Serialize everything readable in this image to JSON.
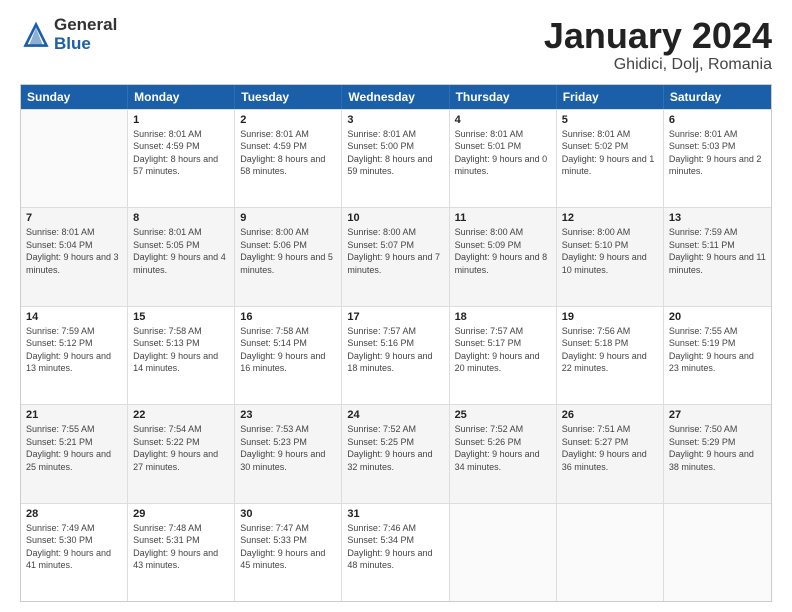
{
  "logo": {
    "general": "General",
    "blue": "Blue"
  },
  "header": {
    "title": "January 2024",
    "subtitle": "Ghidici, Dolj, Romania"
  },
  "weekdays": [
    "Sunday",
    "Monday",
    "Tuesday",
    "Wednesday",
    "Thursday",
    "Friday",
    "Saturday"
  ],
  "weeks": [
    [
      {
        "day": "",
        "sunrise": "",
        "sunset": "",
        "daylight": ""
      },
      {
        "day": "1",
        "sunrise": "Sunrise: 8:01 AM",
        "sunset": "Sunset: 4:59 PM",
        "daylight": "Daylight: 8 hours and 57 minutes."
      },
      {
        "day": "2",
        "sunrise": "Sunrise: 8:01 AM",
        "sunset": "Sunset: 4:59 PM",
        "daylight": "Daylight: 8 hours and 58 minutes."
      },
      {
        "day": "3",
        "sunrise": "Sunrise: 8:01 AM",
        "sunset": "Sunset: 5:00 PM",
        "daylight": "Daylight: 8 hours and 59 minutes."
      },
      {
        "day": "4",
        "sunrise": "Sunrise: 8:01 AM",
        "sunset": "Sunset: 5:01 PM",
        "daylight": "Daylight: 9 hours and 0 minutes."
      },
      {
        "day": "5",
        "sunrise": "Sunrise: 8:01 AM",
        "sunset": "Sunset: 5:02 PM",
        "daylight": "Daylight: 9 hours and 1 minute."
      },
      {
        "day": "6",
        "sunrise": "Sunrise: 8:01 AM",
        "sunset": "Sunset: 5:03 PM",
        "daylight": "Daylight: 9 hours and 2 minutes."
      }
    ],
    [
      {
        "day": "7",
        "sunrise": "Sunrise: 8:01 AM",
        "sunset": "Sunset: 5:04 PM",
        "daylight": "Daylight: 9 hours and 3 minutes."
      },
      {
        "day": "8",
        "sunrise": "Sunrise: 8:01 AM",
        "sunset": "Sunset: 5:05 PM",
        "daylight": "Daylight: 9 hours and 4 minutes."
      },
      {
        "day": "9",
        "sunrise": "Sunrise: 8:00 AM",
        "sunset": "Sunset: 5:06 PM",
        "daylight": "Daylight: 9 hours and 5 minutes."
      },
      {
        "day": "10",
        "sunrise": "Sunrise: 8:00 AM",
        "sunset": "Sunset: 5:07 PM",
        "daylight": "Daylight: 9 hours and 7 minutes."
      },
      {
        "day": "11",
        "sunrise": "Sunrise: 8:00 AM",
        "sunset": "Sunset: 5:09 PM",
        "daylight": "Daylight: 9 hours and 8 minutes."
      },
      {
        "day": "12",
        "sunrise": "Sunrise: 8:00 AM",
        "sunset": "Sunset: 5:10 PM",
        "daylight": "Daylight: 9 hours and 10 minutes."
      },
      {
        "day": "13",
        "sunrise": "Sunrise: 7:59 AM",
        "sunset": "Sunset: 5:11 PM",
        "daylight": "Daylight: 9 hours and 11 minutes."
      }
    ],
    [
      {
        "day": "14",
        "sunrise": "Sunrise: 7:59 AM",
        "sunset": "Sunset: 5:12 PM",
        "daylight": "Daylight: 9 hours and 13 minutes."
      },
      {
        "day": "15",
        "sunrise": "Sunrise: 7:58 AM",
        "sunset": "Sunset: 5:13 PM",
        "daylight": "Daylight: 9 hours and 14 minutes."
      },
      {
        "day": "16",
        "sunrise": "Sunrise: 7:58 AM",
        "sunset": "Sunset: 5:14 PM",
        "daylight": "Daylight: 9 hours and 16 minutes."
      },
      {
        "day": "17",
        "sunrise": "Sunrise: 7:57 AM",
        "sunset": "Sunset: 5:16 PM",
        "daylight": "Daylight: 9 hours and 18 minutes."
      },
      {
        "day": "18",
        "sunrise": "Sunrise: 7:57 AM",
        "sunset": "Sunset: 5:17 PM",
        "daylight": "Daylight: 9 hours and 20 minutes."
      },
      {
        "day": "19",
        "sunrise": "Sunrise: 7:56 AM",
        "sunset": "Sunset: 5:18 PM",
        "daylight": "Daylight: 9 hours and 22 minutes."
      },
      {
        "day": "20",
        "sunrise": "Sunrise: 7:55 AM",
        "sunset": "Sunset: 5:19 PM",
        "daylight": "Daylight: 9 hours and 23 minutes."
      }
    ],
    [
      {
        "day": "21",
        "sunrise": "Sunrise: 7:55 AM",
        "sunset": "Sunset: 5:21 PM",
        "daylight": "Daylight: 9 hours and 25 minutes."
      },
      {
        "day": "22",
        "sunrise": "Sunrise: 7:54 AM",
        "sunset": "Sunset: 5:22 PM",
        "daylight": "Daylight: 9 hours and 27 minutes."
      },
      {
        "day": "23",
        "sunrise": "Sunrise: 7:53 AM",
        "sunset": "Sunset: 5:23 PM",
        "daylight": "Daylight: 9 hours and 30 minutes."
      },
      {
        "day": "24",
        "sunrise": "Sunrise: 7:52 AM",
        "sunset": "Sunset: 5:25 PM",
        "daylight": "Daylight: 9 hours and 32 minutes."
      },
      {
        "day": "25",
        "sunrise": "Sunrise: 7:52 AM",
        "sunset": "Sunset: 5:26 PM",
        "daylight": "Daylight: 9 hours and 34 minutes."
      },
      {
        "day": "26",
        "sunrise": "Sunrise: 7:51 AM",
        "sunset": "Sunset: 5:27 PM",
        "daylight": "Daylight: 9 hours and 36 minutes."
      },
      {
        "day": "27",
        "sunrise": "Sunrise: 7:50 AM",
        "sunset": "Sunset: 5:29 PM",
        "daylight": "Daylight: 9 hours and 38 minutes."
      }
    ],
    [
      {
        "day": "28",
        "sunrise": "Sunrise: 7:49 AM",
        "sunset": "Sunset: 5:30 PM",
        "daylight": "Daylight: 9 hours and 41 minutes."
      },
      {
        "day": "29",
        "sunrise": "Sunrise: 7:48 AM",
        "sunset": "Sunset: 5:31 PM",
        "daylight": "Daylight: 9 hours and 43 minutes."
      },
      {
        "day": "30",
        "sunrise": "Sunrise: 7:47 AM",
        "sunset": "Sunset: 5:33 PM",
        "daylight": "Daylight: 9 hours and 45 minutes."
      },
      {
        "day": "31",
        "sunrise": "Sunrise: 7:46 AM",
        "sunset": "Sunset: 5:34 PM",
        "daylight": "Daylight: 9 hours and 48 minutes."
      },
      {
        "day": "",
        "sunrise": "",
        "sunset": "",
        "daylight": ""
      },
      {
        "day": "",
        "sunrise": "",
        "sunset": "",
        "daylight": ""
      },
      {
        "day": "",
        "sunrise": "",
        "sunset": "",
        "daylight": ""
      }
    ]
  ]
}
